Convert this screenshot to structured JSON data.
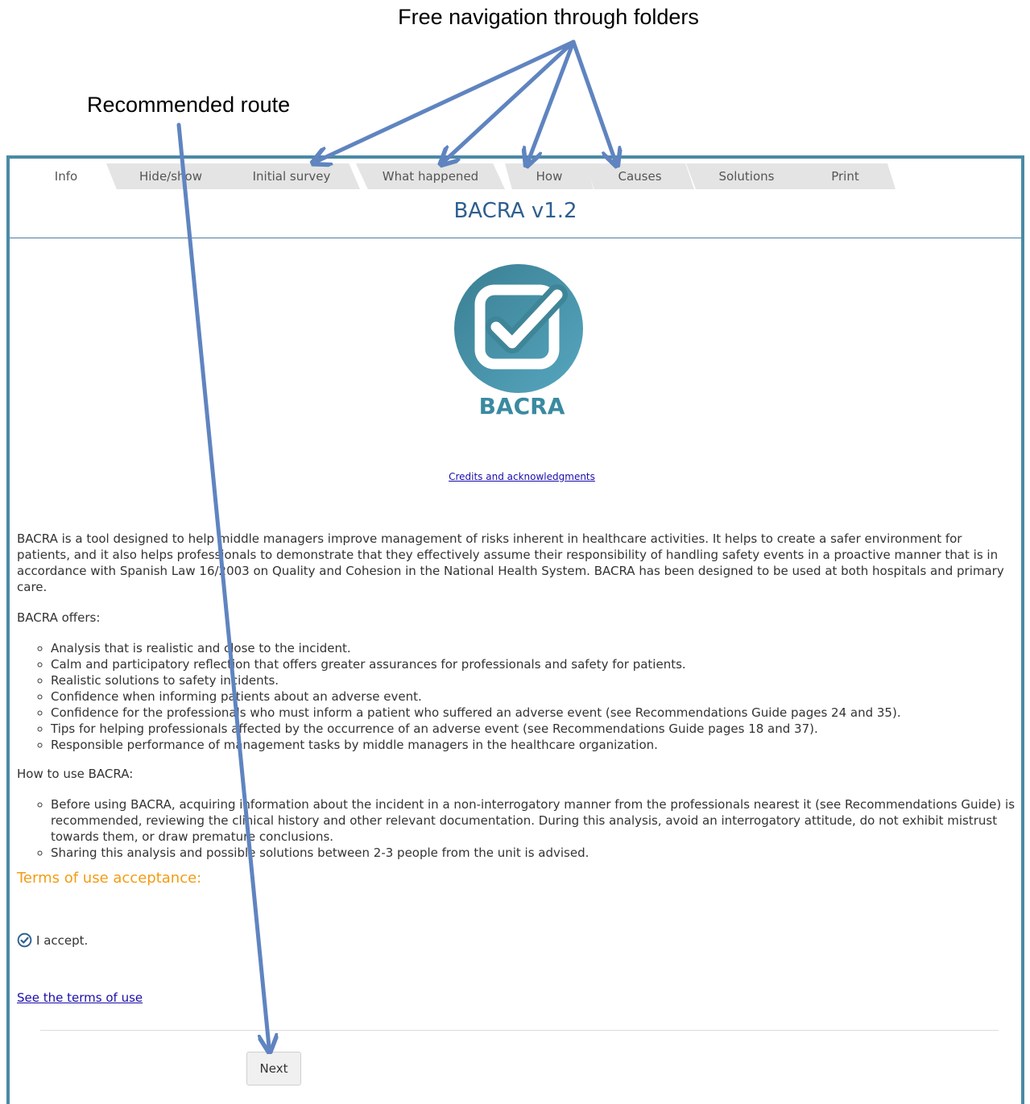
{
  "annotations": {
    "free_navigation": "Free navigation through folders",
    "recommended_route": "Recommended route"
  },
  "tabs": [
    {
      "label": "Info"
    },
    {
      "label": "Hide/show"
    },
    {
      "label": "Initial survey"
    },
    {
      "label": "What happened"
    },
    {
      "label": "How"
    },
    {
      "label": "Causes"
    },
    {
      "label": "Solutions"
    },
    {
      "label": "Print"
    }
  ],
  "app": {
    "title": "BACRA v1.2",
    "logo_text": "BACRA",
    "credits_link": "Credits and acknowledgments"
  },
  "content": {
    "intro": "BACRA is a tool designed to help middle managers improve management of risks inherent in healthcare activities. It helps to create a safer environment for patients, and it also helps professionals to demonstrate that they effectively assume their responsibility of handling safety events in a proactive manner that is in accordance with Spanish Law 16/2003 on Quality and Cohesion in the National Health System. BACRA has been designed to be used at both hospitals and primary care.",
    "offers_heading": "BACRA offers:",
    "offers": [
      "Analysis that is realistic and close to the incident.",
      "Calm and participatory reflection that offers greater assurances for professionals and safety for patients.",
      "Realistic solutions to safety incidents.",
      "Confidence when informing patients about an adverse event.",
      "Confidence for the professionals who must inform a patient who suffered an adverse event (see Recommendations Guide pages 24 and 35).",
      "Tips for helping professionals affected by the occurrence of an adverse event (see Recommendations Guide pages 18 and 37).",
      "Responsible performance of management tasks by middle managers in the healthcare organization."
    ],
    "howto_heading": "How to use BACRA:",
    "howto": [
      "Before using BACRA, acquiring information about the incident in a non-interrogatory manner from the professionals nearest it (see Recommendations Guide) is recommended, reviewing the clinical history and other relevant documentation. During this analysis, avoid an interrogatory attitude, do not exhibit mistrust towards them, or draw premature conclusions.",
      "Sharing this analysis and possible solutions between 2-3 people from the unit is advised."
    ]
  },
  "terms": {
    "heading": "Terms of use acceptance:",
    "accept_label": "I accept.",
    "accepted": true,
    "see_terms_link": "See the terms of use"
  },
  "buttons": {
    "next": "Next"
  },
  "colors": {
    "frame": "#4a8aa5",
    "title": "#2e5f8f",
    "logo": "#3a8aa1",
    "terms_heading": "#f39c12",
    "arrow": "#5f84c0",
    "link": "#1a0dab"
  }
}
